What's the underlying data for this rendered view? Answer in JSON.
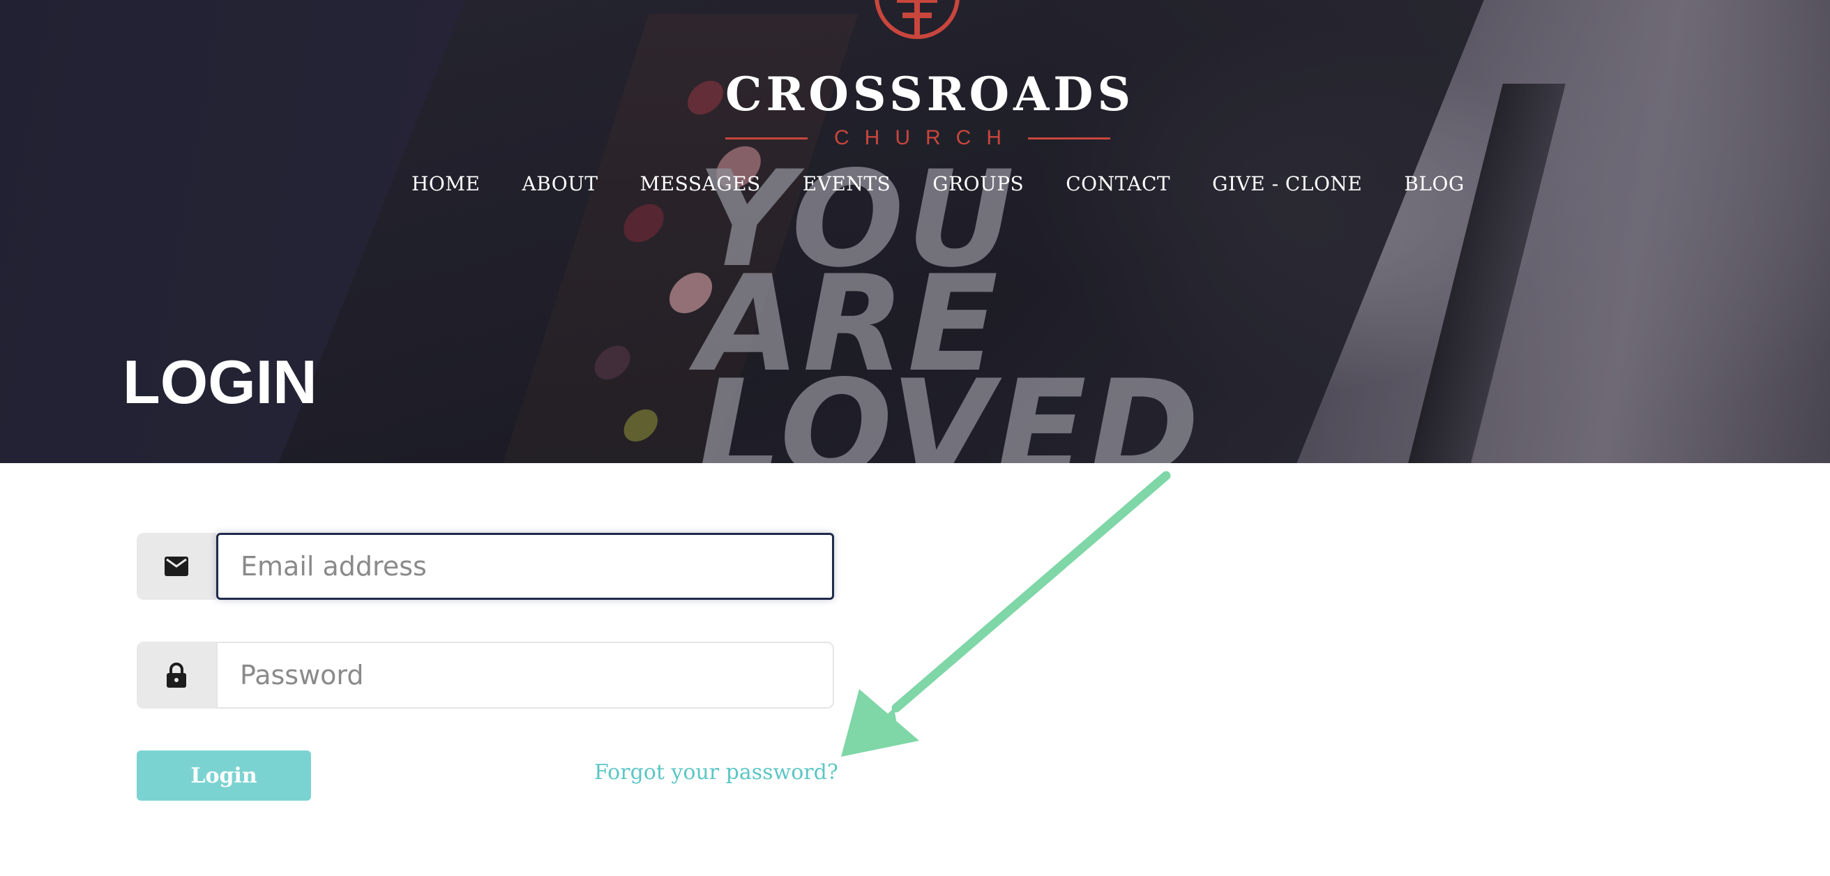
{
  "brand": {
    "name": "CROSSROADS",
    "subtitle": "CHURCH",
    "accent_color": "#c9463d"
  },
  "nav": {
    "items": [
      "HOME",
      "ABOUT",
      "MESSAGES",
      "EVENTS",
      "GROUPS",
      "CONTACT",
      "GIVE - CLONE",
      "BLOG"
    ]
  },
  "hero": {
    "title": "LOGIN",
    "background_text": [
      "YOU",
      "ARE",
      "LOVED"
    ]
  },
  "form": {
    "email": {
      "placeholder": "Email address",
      "value": "",
      "icon": "envelope-icon"
    },
    "password": {
      "placeholder": "Password",
      "value": "",
      "icon": "lock-icon"
    },
    "login_label": "Login",
    "forgot_label": "Forgot your password?",
    "button_color": "#7bd3d1",
    "link_color": "#5cc6c4"
  },
  "annotation": {
    "arrow_color": "#7fd6a6",
    "points_to": "forgot-password-link"
  }
}
